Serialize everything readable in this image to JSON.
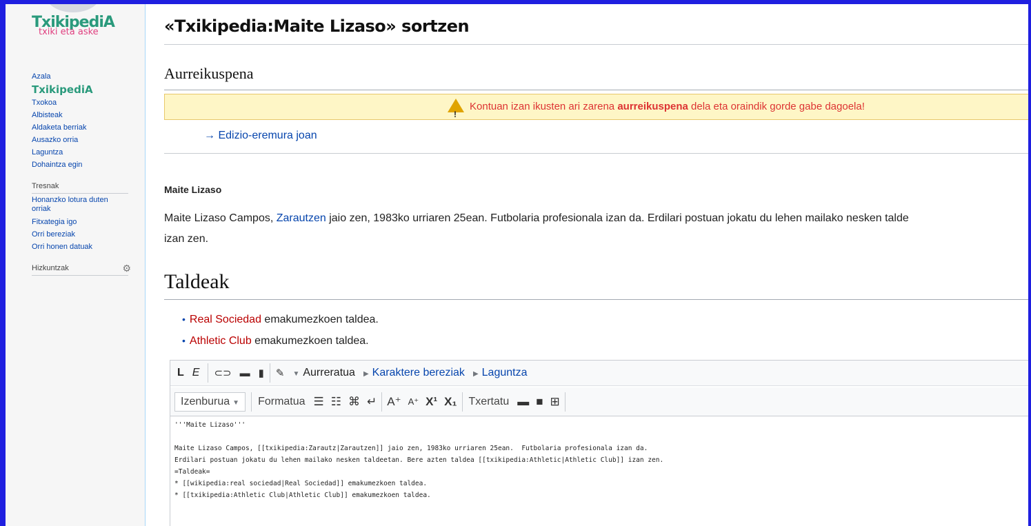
{
  "sidebar": {
    "logo_main": "TxikipediA",
    "logo_sub": "txiki eta aske",
    "nav_items": [
      {
        "label": "Azala"
      },
      {
        "label": "TxikipediA"
      },
      {
        "label": "Txokoa"
      },
      {
        "label": "Albisteak"
      },
      {
        "label": "Aldaketa berriak"
      },
      {
        "label": "Ausazko orria"
      },
      {
        "label": "Laguntza"
      },
      {
        "label": "Dohaintza egin"
      }
    ],
    "tools_heading": "Tresnak",
    "tools_items": [
      {
        "label": "Honanzko lotura duten orriak"
      },
      {
        "label": "Fitxategia igo"
      },
      {
        "label": "Orri bereziak"
      },
      {
        "label": "Orri honen datuak"
      }
    ],
    "languages_heading": "Hizkuntzak",
    "languages_icon": "gear-icon"
  },
  "page": {
    "title": "«Txikipedia:Maite Lizaso» sortzen",
    "preview_heading": "Aurreikuspena",
    "warning_before": "Kontuan izan ikusten ari zarena ",
    "warning_bold": "aurreikuspena",
    "warning_after": " dela eta oraindik gorde gabe dagoela!",
    "goto_label": "→ Edizio-eremura joan",
    "name_bold": "Maite Lizaso",
    "para_part1": "Maite Lizaso Campos, ",
    "para_link": "Zarautzen",
    "para_part2": " jaio zen, 1983ko urriaren 25ean. Futbolaria profesionala izan da. Erdilari postuan jokatu du lehen mailako nesken talde",
    "para_line2": "izan zen.",
    "section_heading": "Taldeak",
    "teams": [
      {
        "link": "Real Sociedad",
        "rest": " emakumezkoen taldea."
      },
      {
        "link": "Athletic Club",
        "rest": " emakumezkoen taldea."
      }
    ]
  },
  "editor": {
    "toolbar1": {
      "bold": "L",
      "italic": "E",
      "advanced": "Aurreratua",
      "special_chars": "Karaktere bereziak",
      "help": "Laguntza"
    },
    "toolbar2": {
      "heading_select": "Izenburua",
      "format": "Formatua",
      "insert": "Txertatu"
    },
    "wikitext_lines": [
      "'''Maite Lizaso'''",
      "",
      "Maite Lizaso Campos, [[txikipedia:Zarautz|Zarautzen]] jaio zen, 1983ko urriaren 25ean.  Futbolaria profesionala izan da.",
      "Erdilari postuan jokatu du lehen mailako nesken taldeetan. Bere azten taldea [[txikipedia:Athletic|Athletic Club]] izan zen.",
      "=Taldeak=",
      "* [[wikipedia:real sociedad|Real Sociedad]] emakumezkoen taldea.",
      "* [[txikipedia:Athletic Club|Athletic Club]] emakumezkoen taldea."
    ]
  },
  "colors": {
    "frame": "#1f1fe0",
    "link": "#0645ad",
    "redlink": "#ba0000",
    "warning_bg": "#fef6c6",
    "warning_text": "#d33"
  }
}
